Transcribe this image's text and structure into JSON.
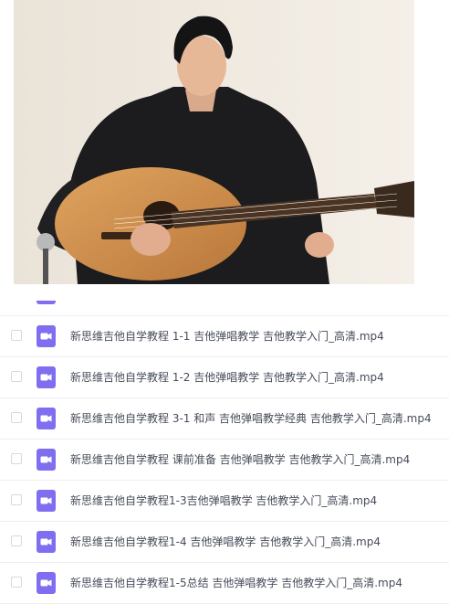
{
  "colors": {
    "file_icon": "#7f6ff0",
    "row_divider": "#eceef2",
    "text": "#474d5a"
  },
  "preview": {
    "icon": "video-thumbnail"
  },
  "files": [
    {
      "name": "新思维吉他自学教程 1-1 吉他弹唱教学 吉他教学入门_高清.mp4",
      "icon": "video-file-icon"
    },
    {
      "name": "新思维吉他自学教程 1-2 吉他弹唱教学 吉他教学入门_高清.mp4",
      "icon": "video-file-icon"
    },
    {
      "name": "新思维吉他自学教程 3-1 和声 吉他弹唱教学经典 吉他教学入门_高清.mp4",
      "icon": "video-file-icon"
    },
    {
      "name": "新思维吉他自学教程 课前准备 吉他弹唱教学 吉他教学入门_高清.mp4",
      "icon": "video-file-icon"
    },
    {
      "name": "新思维吉他自学教程1-3吉他弹唱教学 吉他教学入门_高清.mp4",
      "icon": "video-file-icon"
    },
    {
      "name": "新思维吉他自学教程1-4 吉他弹唱教学 吉他教学入门_高清.mp4",
      "icon": "video-file-icon"
    },
    {
      "name": "新思维吉他自学教程1-5总结 吉他弹唱教学 吉他教学入门_高清.mp4",
      "icon": "video-file-icon"
    }
  ]
}
